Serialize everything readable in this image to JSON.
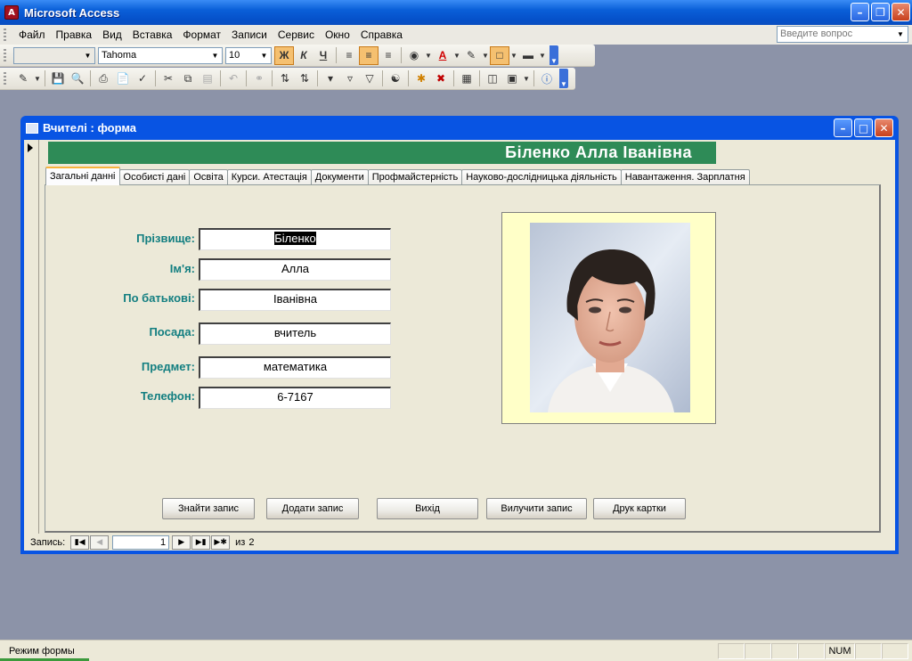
{
  "app": {
    "title": "Microsoft Access",
    "icon_text": "A"
  },
  "menu": {
    "items": [
      "Файл",
      "Правка",
      "Вид",
      "Вставка",
      "Формат",
      "Записи",
      "Сервис",
      "Окно",
      "Справка"
    ],
    "help_placeholder": "Введите вопрос"
  },
  "toolbar_format": {
    "object_combo": "",
    "font_name": "Tahoma",
    "font_size": "10",
    "bold_label": "Ж",
    "italic_label": "К",
    "underline_label": "Ч"
  },
  "form_window": {
    "title": "Вчителі : форма",
    "header_name": "Біленко  Алла  Іванівна",
    "tabs": [
      {
        "label": "Загальні данні",
        "active": true
      },
      {
        "label": "Особисті дані",
        "active": false
      },
      {
        "label": "Освіта",
        "active": false
      },
      {
        "label": "Курси. Атестація",
        "active": false
      },
      {
        "label": "Документи",
        "active": false
      },
      {
        "label": "Профмайстерність",
        "active": false
      },
      {
        "label": "Науково-дослідницька діяльність",
        "active": false
      },
      {
        "label": "Навантаження. Зарплатня",
        "active": false
      }
    ],
    "fields": [
      {
        "label": "Прізвище:",
        "value": "Біленко"
      },
      {
        "label": "Ім'я:",
        "value": "Алла"
      },
      {
        "label": "По батькові:",
        "value": "Іванівна"
      },
      {
        "label": "Посада:",
        "value": "вчитель"
      },
      {
        "label": "Предмет:",
        "value": "математика"
      },
      {
        "label": "Телефон:",
        "value": "6-7167"
      }
    ],
    "buttons": {
      "find": "Знайти запис",
      "add": "Додати запис",
      "exit": "Вихід",
      "delete": "Вилучити запис",
      "print": "Друк картки"
    },
    "navigation": {
      "label": "Запись:",
      "current": "1",
      "of_label": "из",
      "total": "2"
    }
  },
  "statusbar": {
    "mode": "Режим формы",
    "num": "NUM"
  },
  "colors": {
    "title_blue": "#0854E3",
    "header_green": "#2E8B57",
    "label_teal": "#127E80",
    "photo_frame": "#FFFFC8",
    "desktop": "#8C93A8"
  }
}
